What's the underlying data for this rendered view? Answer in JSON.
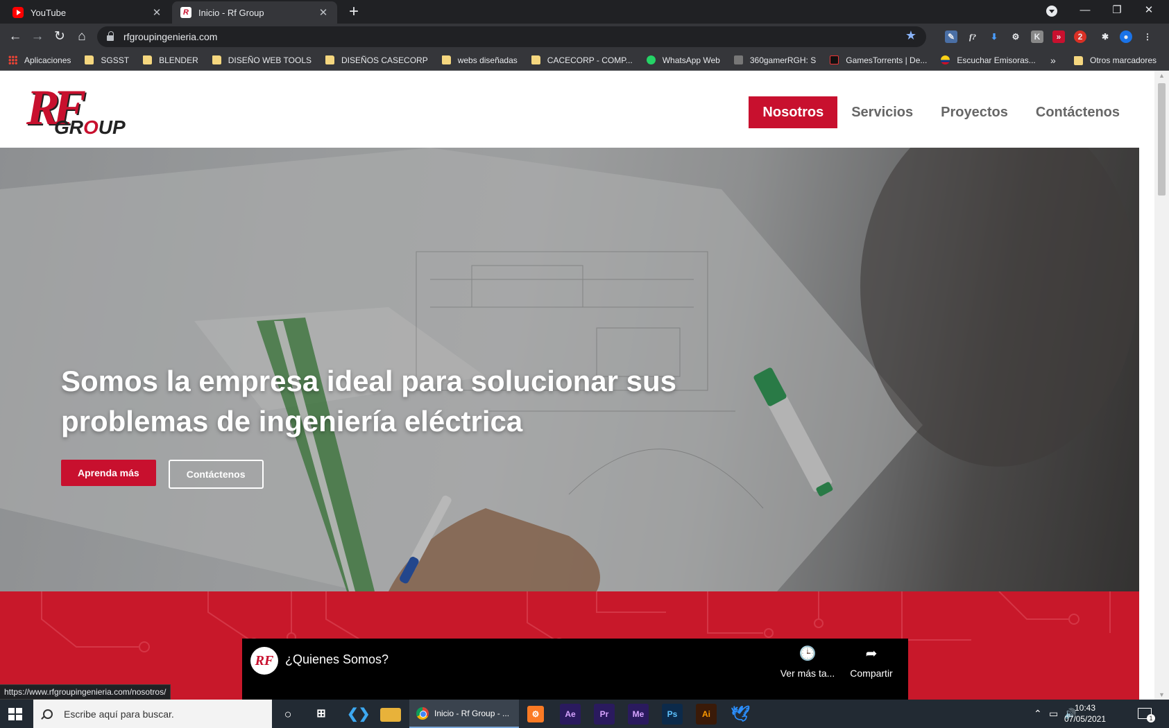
{
  "browser": {
    "tabs": [
      {
        "title": "YouTube",
        "active": false,
        "favicon": "youtube-icon"
      },
      {
        "title": "Inicio - Rf Group",
        "active": true,
        "favicon": "rfgroup-icon"
      }
    ],
    "url": "rfgroupingenieria.com",
    "bookmarks": [
      {
        "label": "Aplicaciones",
        "icon": "apps-icon"
      },
      {
        "label": "SGSST",
        "icon": "folder-icon"
      },
      {
        "label": "BLENDER",
        "icon": "folder-icon"
      },
      {
        "label": "DISEÑO WEB TOOLS",
        "icon": "folder-icon"
      },
      {
        "label": "DISEÑOS CASECORP",
        "icon": "folder-icon"
      },
      {
        "label": "webs diseñadas",
        "icon": "folder-icon"
      },
      {
        "label": "CACECORP - COMP...",
        "icon": "folder-icon"
      },
      {
        "label": "WhatsApp Web",
        "icon": "whatsapp-icon"
      },
      {
        "label": "360gamerRGH: S",
        "icon": "gamepad-icon"
      },
      {
        "label": "GamesTorrents | De...",
        "icon": "gamestorrents-icon"
      },
      {
        "label": "Escuchar Emisoras...",
        "icon": "colombia-flag-icon"
      }
    ],
    "bookmarks_more": "»",
    "other_bookmarks": "Otros marcadores",
    "status_url": "https://www.rfgroupingenieria.com/nosotros/"
  },
  "site": {
    "logo": {
      "rf": "RF",
      "group_pre": "GR",
      "group_o": "O",
      "group_post": "UP"
    },
    "nav": [
      {
        "label": "Nosotros",
        "active": true
      },
      {
        "label": "Servicios",
        "active": false
      },
      {
        "label": "Proyectos",
        "active": false
      },
      {
        "label": "Contáctenos",
        "active": false
      }
    ],
    "hero": {
      "title_line1": "Somos la empresa ideal para solucionar sus",
      "title_line2": "problemas de ingeniería eléctrica",
      "primary_button": "Aprenda más",
      "secondary_button": "Contáctenos"
    },
    "video": {
      "title": "¿Quienes Somos?",
      "logo": "RF",
      "watch_later": "Ver más ta...",
      "share": "Compartir"
    },
    "colors": {
      "brand_red": "#c8102e",
      "section_red": "#c8182a"
    }
  },
  "taskbar": {
    "search_placeholder": "Escribe aquí para buscar.",
    "chrome_label": "Inicio - Rf Group - ...",
    "apps": [
      "Ae",
      "Pr",
      "Me",
      "Ps",
      "Ai"
    ],
    "time": "10:43",
    "date": "07/05/2021",
    "notifications": "1"
  }
}
